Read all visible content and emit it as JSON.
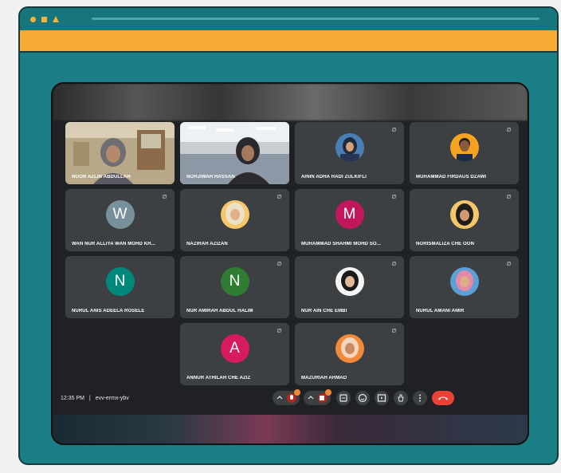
{
  "colors": {
    "frame_teal": "#1b7d85",
    "accent_orange": "#f7ab34",
    "tile_bg": "#3c4043",
    "end_call": "#ea4335"
  },
  "meeting": {
    "time": "12:35 PM",
    "separator": "|",
    "code": "evv-ermx-ybv"
  },
  "participants": [
    {
      "name": "NOOR AZLIN ABDULLAH",
      "type": "video"
    },
    {
      "name": "NORJIWAH HASSAN",
      "type": "video"
    },
    {
      "name": "AININ ADHA HADI ZULKIFLI",
      "type": "photo",
      "muted": true
    },
    {
      "name": "MUHAMMAD FIRDAUS DZAWI",
      "type": "photo",
      "muted": true
    },
    {
      "name": "WAN NUR ALLIYA WAN MOHD KH...",
      "type": "initial",
      "initial": "W",
      "color": "#78909c",
      "muted": true
    },
    {
      "name": "NAZIRAH AZIZAN",
      "type": "photo",
      "muted": true
    },
    {
      "name": "MUHAMMAD SHAHMI MOHD SO...",
      "type": "initial",
      "initial": "M",
      "color": "#c2185b",
      "muted": true
    },
    {
      "name": "NORISMALIZA CHE OON",
      "type": "photo",
      "muted": true
    },
    {
      "name": "NURUL ANIS ADEELA ROSELE",
      "type": "initial",
      "initial": "N",
      "color": "#00897b",
      "muted": false
    },
    {
      "name": "NUR AMIRAH ABDUL HALIM",
      "type": "initial",
      "initial": "N",
      "color": "#2e7d32",
      "muted": true
    },
    {
      "name": "NUR AIN CHE EMBI",
      "type": "photo",
      "muted": true
    },
    {
      "name": "NURUL AMANI AMIR",
      "type": "photo",
      "muted": true
    },
    {
      "name": "ANNUR ATHILAH CHE AZIZ",
      "type": "initial",
      "initial": "A",
      "color": "#d81b60",
      "muted": true
    },
    {
      "name": "MAZURIAH AHMAD",
      "type": "photo",
      "muted": true
    }
  ],
  "controls": {
    "items": [
      "mic-toggle",
      "camera-toggle",
      "captions",
      "emoji",
      "present",
      "raise-hand",
      "more-options",
      "leave-call"
    ]
  }
}
